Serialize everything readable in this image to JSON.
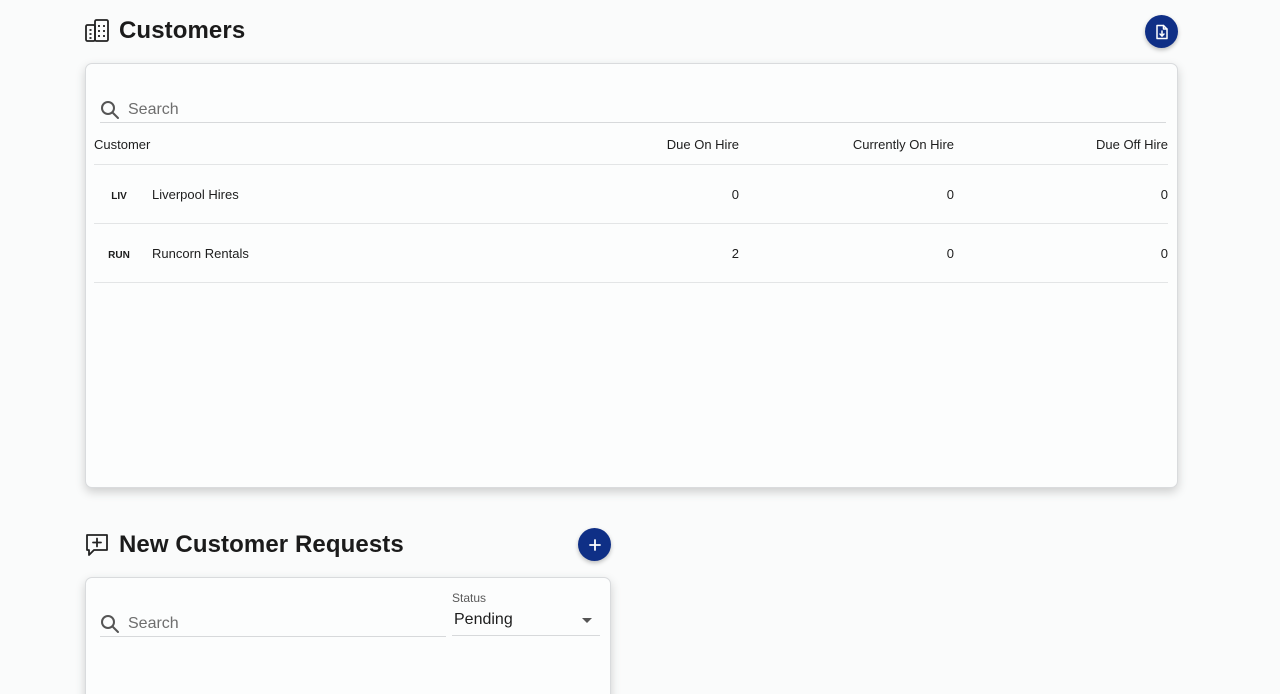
{
  "customers_section": {
    "title": "Customers",
    "icon": "building-icon",
    "export_button_icon": "file-download-icon",
    "search": {
      "placeholder": "Search",
      "value": ""
    },
    "columns": [
      "Customer",
      "Due On Hire",
      "Currently On Hire",
      "Due Off Hire"
    ],
    "rows": [
      {
        "code": "LIV",
        "name": "Liverpool Hires",
        "due_on_hire": "0",
        "currently_on_hire": "0",
        "due_off_hire": "0"
      },
      {
        "code": "RUN",
        "name": "Runcorn Rentals",
        "due_on_hire": "2",
        "currently_on_hire": "0",
        "due_off_hire": "0"
      }
    ]
  },
  "requests_section": {
    "title": "New Customer Requests",
    "icon": "comment-plus-icon",
    "add_button_icon": "plus-icon",
    "search": {
      "placeholder": "Search",
      "value": ""
    },
    "status_filter": {
      "label": "Status",
      "value": "Pending"
    }
  },
  "colors": {
    "accent": "#0f2f86",
    "background": "#fafbfb",
    "card": "#fcfdfd",
    "divider": "#e3e5e6"
  }
}
